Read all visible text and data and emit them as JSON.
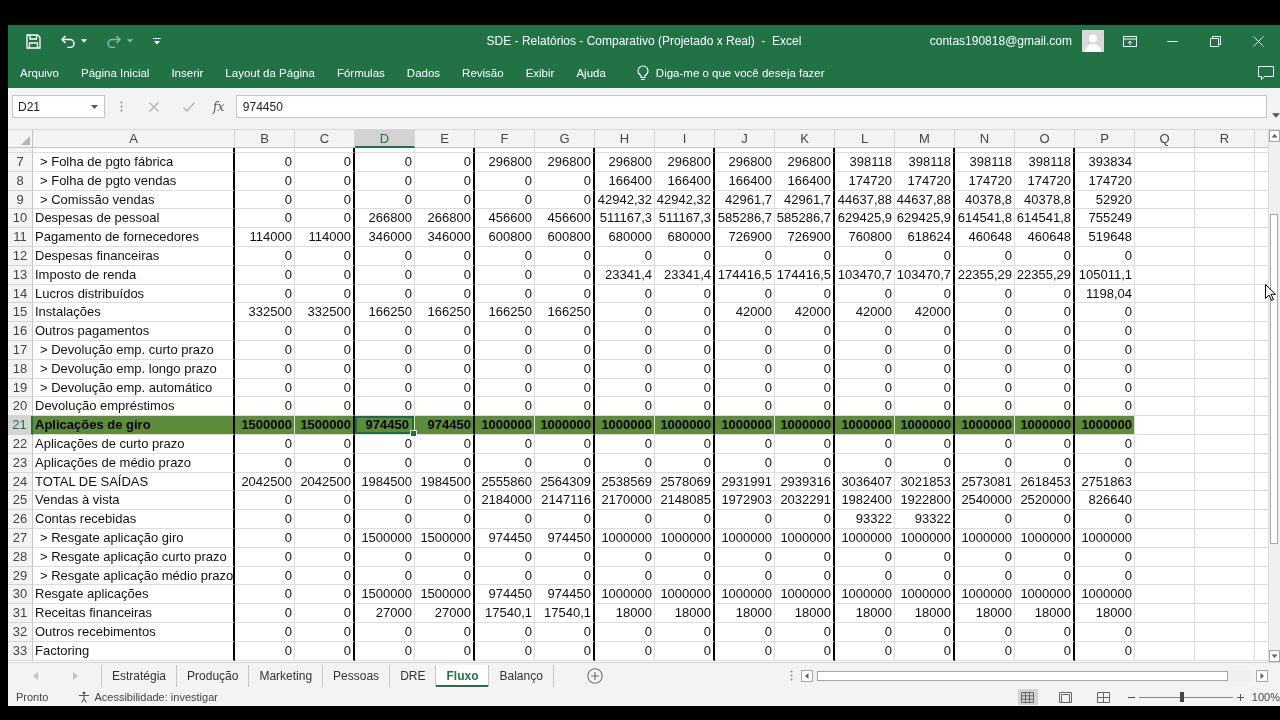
{
  "title_bar": {
    "title": "SDE - Relatórios - Comparativo (Projetado x Real)  -  Excel",
    "account": "contas190818@gmail.com"
  },
  "quick_access": {
    "undo": {
      "disabled": false
    },
    "redo": {
      "disabled": true
    }
  },
  "ribbon_tabs": [
    {
      "label": "Arquivo",
      "selected": false
    },
    {
      "label": "Página Inicial",
      "selected": false
    },
    {
      "label": "Inserir",
      "selected": false
    },
    {
      "label": "Layout da Página",
      "selected": false
    },
    {
      "label": "Fórmulas",
      "selected": false
    },
    {
      "label": "Dados",
      "selected": false
    },
    {
      "label": "Revisão",
      "selected": false
    },
    {
      "label": "Exibir",
      "selected": false
    },
    {
      "label": "Ajuda",
      "selected": false
    }
  ],
  "tell_me": {
    "placeholder": "Diga-me o que você deseja fazer"
  },
  "formula_bar": {
    "name_box": "D21",
    "function_button": "fx",
    "formula": "974450"
  },
  "columns": [
    {
      "label": "A",
      "selected": false,
      "divider": true
    },
    {
      "label": "B",
      "selected": false,
      "divider": false
    },
    {
      "label": "C",
      "selected": false,
      "divider": true
    },
    {
      "label": "D",
      "selected": true,
      "divider": false
    },
    {
      "label": "E",
      "selected": false,
      "divider": true
    },
    {
      "label": "F",
      "selected": false,
      "divider": false
    },
    {
      "label": "G",
      "selected": false,
      "divider": true
    },
    {
      "label": "H",
      "selected": false,
      "divider": false
    },
    {
      "label": "I",
      "selected": false,
      "divider": true
    },
    {
      "label": "J",
      "selected": false,
      "divider": false
    },
    {
      "label": "K",
      "selected": false,
      "divider": true
    },
    {
      "label": "L",
      "selected": false,
      "divider": false
    },
    {
      "label": "M",
      "selected": false,
      "divider": true
    },
    {
      "label": "N",
      "selected": false,
      "divider": false
    },
    {
      "label": "O",
      "selected": false,
      "divider": true
    },
    {
      "label": "P",
      "selected": false,
      "divider": false
    },
    {
      "label": "Q",
      "selected": false,
      "divider": false
    },
    {
      "label": "R",
      "selected": false,
      "divider": false
    }
  ],
  "rows": [
    {
      "number": "7",
      "label": "> Folha de pgto fábrica",
      "kind": "sub",
      "selected": false,
      "values": [
        "0",
        "0",
        "0",
        "0",
        "296800",
        "296800",
        "296800",
        "296800",
        "296800",
        "296800",
        "398118",
        "398118",
        "398118",
        "398118",
        "393834"
      ]
    },
    {
      "number": "8",
      "label": "> Folha de pgto vendas",
      "kind": "sub",
      "selected": false,
      "values": [
        "0",
        "0",
        "0",
        "0",
        "0",
        "0",
        "166400",
        "166400",
        "166400",
        "166400",
        "174720",
        "174720",
        "174720",
        "174720",
        "174720"
      ]
    },
    {
      "number": "9",
      "label": "> Comissão vendas",
      "kind": "sub",
      "selected": false,
      "values": [
        "0",
        "0",
        "0",
        "0",
        "0",
        "0",
        "42942,32",
        "42942,32",
        "42961,7",
        "42961,7",
        "44637,88",
        "44637,88",
        "40378,8",
        "40378,8",
        "52920"
      ]
    },
    {
      "number": "10",
      "label": "Despesas de pessoal",
      "kind": "main",
      "selected": false,
      "values": [
        "0",
        "0",
        "266800",
        "266800",
        "456600",
        "456600",
        "511167,3",
        "511167,3",
        "585286,7",
        "585286,7",
        "629425,9",
        "629425,9",
        "614541,8",
        "614541,8",
        "755249"
      ]
    },
    {
      "number": "11",
      "label": "Pagamento de fornecedores",
      "kind": "main",
      "selected": false,
      "values": [
        "114000",
        "114000",
        "346000",
        "346000",
        "600800",
        "600800",
        "680000",
        "680000",
        "726900",
        "726900",
        "760800",
        "618624",
        "460648",
        "460648",
        "519648"
      ]
    },
    {
      "number": "12",
      "label": "Despesas financeiras",
      "kind": "main",
      "selected": false,
      "values": [
        "0",
        "0",
        "0",
        "0",
        "0",
        "0",
        "0",
        "0",
        "0",
        "0",
        "0",
        "0",
        "0",
        "0",
        "0"
      ]
    },
    {
      "number": "13",
      "label": "Imposto de renda",
      "kind": "main",
      "selected": false,
      "values": [
        "0",
        "0",
        "0",
        "0",
        "0",
        "0",
        "23341,4",
        "23341,4",
        "174416,5",
        "174416,5",
        "103470,7",
        "103470,7",
        "22355,29",
        "22355,29",
        "105011,1"
      ]
    },
    {
      "number": "14",
      "label": "Lucros distribuídos",
      "kind": "main",
      "selected": false,
      "values": [
        "0",
        "0",
        "0",
        "0",
        "0",
        "0",
        "0",
        "0",
        "0",
        "0",
        "0",
        "0",
        "0",
        "0",
        "1198,04"
      ]
    },
    {
      "number": "15",
      "label": "Instalações",
      "kind": "main",
      "selected": false,
      "values": [
        "332500",
        "332500",
        "166250",
        "166250",
        "166250",
        "166250",
        "0",
        "0",
        "42000",
        "42000",
        "42000",
        "42000",
        "0",
        "0",
        "0"
      ]
    },
    {
      "number": "16",
      "label": "Outros pagamentos",
      "kind": "main",
      "selected": false,
      "values": [
        "0",
        "0",
        "0",
        "0",
        "0",
        "0",
        "0",
        "0",
        "0",
        "0",
        "0",
        "0",
        "0",
        "0",
        "0"
      ]
    },
    {
      "number": "17",
      "label": "> Devolução emp. curto prazo",
      "kind": "sub",
      "selected": false,
      "values": [
        "0",
        "0",
        "0",
        "0",
        "0",
        "0",
        "0",
        "0",
        "0",
        "0",
        "0",
        "0",
        "0",
        "0",
        "0"
      ]
    },
    {
      "number": "18",
      "label": "> Devolução emp. longo prazo",
      "kind": "sub",
      "selected": false,
      "values": [
        "0",
        "0",
        "0",
        "0",
        "0",
        "0",
        "0",
        "0",
        "0",
        "0",
        "0",
        "0",
        "0",
        "0",
        "0"
      ]
    },
    {
      "number": "19",
      "label": "> Devolução emp. automático",
      "kind": "sub",
      "selected": false,
      "values": [
        "0",
        "0",
        "0",
        "0",
        "0",
        "0",
        "0",
        "0",
        "0",
        "0",
        "0",
        "0",
        "0",
        "0",
        "0"
      ]
    },
    {
      "number": "20",
      "label": "Devolução empréstimos",
      "kind": "main",
      "selected": false,
      "values": [
        "0",
        "0",
        "0",
        "0",
        "0",
        "0",
        "0",
        "0",
        "0",
        "0",
        "0",
        "0",
        "0",
        "0",
        "0"
      ]
    },
    {
      "number": "21",
      "label": "Aplicações de giro",
      "kind": "highlight",
      "selected": true,
      "values": [
        "1500000",
        "1500000",
        "974450",
        "974450",
        "1000000",
        "1000000",
        "1000000",
        "1000000",
        "1000000",
        "1000000",
        "1000000",
        "1000000",
        "1000000",
        "1000000",
        "1000000"
      ]
    },
    {
      "number": "22",
      "label": "Aplicações de curto prazo",
      "kind": "main",
      "selected": false,
      "values": [
        "0",
        "0",
        "0",
        "0",
        "0",
        "0",
        "0",
        "0",
        "0",
        "0",
        "0",
        "0",
        "0",
        "0",
        "0"
      ]
    },
    {
      "number": "23",
      "label": "Aplicações de médio prazo",
      "kind": "main",
      "selected": false,
      "values": [
        "0",
        "0",
        "0",
        "0",
        "0",
        "0",
        "0",
        "0",
        "0",
        "0",
        "0",
        "0",
        "0",
        "0",
        "0"
      ]
    },
    {
      "number": "24",
      "label": "TOTAL DE SAÍDAS",
      "kind": "main",
      "selected": false,
      "values": [
        "2042500",
        "2042500",
        "1984500",
        "1984500",
        "2555860",
        "2564309",
        "2538569",
        "2578069",
        "2931991",
        "2939316",
        "3036407",
        "3021853",
        "2573081",
        "2618453",
        "2751863"
      ]
    },
    {
      "number": "25",
      "label": "Vendas à vista",
      "kind": "main",
      "selected": false,
      "values": [
        "0",
        "0",
        "0",
        "0",
        "2184000",
        "2147116",
        "2170000",
        "2148085",
        "1972903",
        "2032291",
        "1982400",
        "1922800",
        "2540000",
        "2520000",
        "826640"
      ]
    },
    {
      "number": "26",
      "label": "Contas recebidas",
      "kind": "main",
      "selected": false,
      "values": [
        "0",
        "0",
        "0",
        "0",
        "0",
        "0",
        "0",
        "0",
        "0",
        "0",
        "93322",
        "93322",
        "0",
        "0",
        "0"
      ]
    },
    {
      "number": "27",
      "label": "> Resgate aplicação giro",
      "kind": "sub",
      "selected": false,
      "values": [
        "0",
        "0",
        "1500000",
        "1500000",
        "974450",
        "974450",
        "1000000",
        "1000000",
        "1000000",
        "1000000",
        "1000000",
        "1000000",
        "1000000",
        "1000000",
        "1000000"
      ]
    },
    {
      "number": "28",
      "label": "> Resgate aplicação curto prazo",
      "kind": "sub",
      "selected": false,
      "values": [
        "0",
        "0",
        "0",
        "0",
        "0",
        "0",
        "0",
        "0",
        "0",
        "0",
        "0",
        "0",
        "0",
        "0",
        "0"
      ]
    },
    {
      "number": "29",
      "label": "> Resgate aplicação médio prazo",
      "kind": "sub",
      "selected": false,
      "values": [
        "0",
        "0",
        "0",
        "0",
        "0",
        "0",
        "0",
        "0",
        "0",
        "0",
        "0",
        "0",
        "0",
        "0",
        "0"
      ]
    },
    {
      "number": "30",
      "label": "Resgate aplicações",
      "kind": "main",
      "selected": false,
      "values": [
        "0",
        "0",
        "1500000",
        "1500000",
        "974450",
        "974450",
        "1000000",
        "1000000",
        "1000000",
        "1000000",
        "1000000",
        "1000000",
        "1000000",
        "1000000",
        "1000000"
      ]
    },
    {
      "number": "31",
      "label": "Receitas financeiras",
      "kind": "main",
      "selected": false,
      "values": [
        "0",
        "0",
        "27000",
        "27000",
        "17540,1",
        "17540,1",
        "18000",
        "18000",
        "18000",
        "18000",
        "18000",
        "18000",
        "18000",
        "18000",
        "18000"
      ]
    },
    {
      "number": "32",
      "label": "Outros recebimentos",
      "kind": "main",
      "selected": false,
      "values": [
        "0",
        "0",
        "0",
        "0",
        "0",
        "0",
        "0",
        "0",
        "0",
        "0",
        "0",
        "0",
        "0",
        "0",
        "0"
      ]
    },
    {
      "number": "33",
      "label": "Factoring",
      "kind": "main",
      "selected": false,
      "values": [
        "0",
        "0",
        "0",
        "0",
        "0",
        "0",
        "0",
        "0",
        "0",
        "0",
        "0",
        "0",
        "0",
        "0",
        "0"
      ]
    }
  ],
  "sheet_tabs": [
    {
      "label": "Estratégia",
      "selected": false
    },
    {
      "label": "Produção",
      "selected": false
    },
    {
      "label": "Marketing",
      "selected": false
    },
    {
      "label": "Pessoas",
      "selected": false
    },
    {
      "label": "DRE",
      "selected": false
    },
    {
      "label": "Fluxo",
      "selected": true
    },
    {
      "label": "Balanço",
      "selected": false
    }
  ],
  "status_bar": {
    "status": "Pronto",
    "accessibility": "Acessibilidade: investigar",
    "views": {
      "normal": {
        "selected": true
      },
      "page_layout": {
        "selected": false
      },
      "page_break": {
        "selected": false
      }
    },
    "zoom": {
      "level": 0.46
    },
    "zoom_reading": "100%"
  }
}
